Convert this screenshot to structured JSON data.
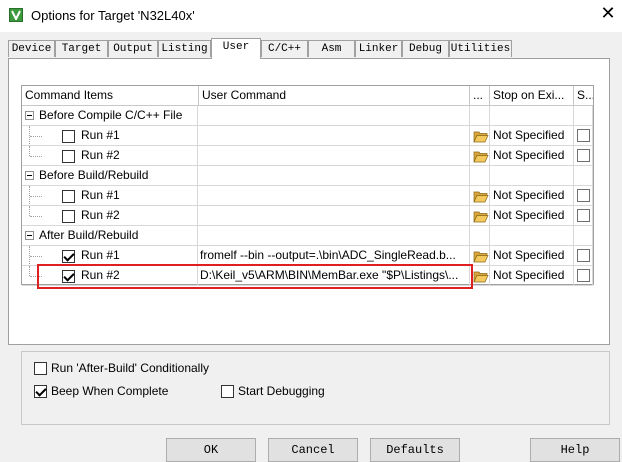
{
  "window": {
    "title": "Options for Target 'N32L40x'",
    "close_glyph": "✕"
  },
  "tabs": [
    {
      "label": "Device"
    },
    {
      "label": "Target"
    },
    {
      "label": "Output"
    },
    {
      "label": "Listing"
    },
    {
      "label": "User"
    },
    {
      "label": "C/C++"
    },
    {
      "label": "Asm"
    },
    {
      "label": "Linker"
    },
    {
      "label": "Debug"
    },
    {
      "label": "Utilities"
    }
  ],
  "active_tab": "User",
  "grid": {
    "headers": {
      "items": "Command Items",
      "command": "User Command",
      "browse": "...",
      "stop": "Stop on Exi...",
      "s": "S..."
    },
    "groups": [
      {
        "label": "Before Compile C/C++ File",
        "runs": [
          {
            "label": "Run #1",
            "checked": false,
            "command": "",
            "stop": "Not Specified"
          },
          {
            "label": "Run #2",
            "checked": false,
            "command": "",
            "stop": "Not Specified"
          }
        ]
      },
      {
        "label": "Before Build/Rebuild",
        "runs": [
          {
            "label": "Run #1",
            "checked": false,
            "command": "",
            "stop": "Not Specified"
          },
          {
            "label": "Run #2",
            "checked": false,
            "command": "",
            "stop": "Not Specified"
          }
        ]
      },
      {
        "label": "After Build/Rebuild",
        "runs": [
          {
            "label": "Run #1",
            "checked": true,
            "command": "fromelf --bin --output=.\\bin\\ADC_SingleRead.b...",
            "stop": "Not Specified"
          },
          {
            "label": "Run #2",
            "checked": true,
            "command": "D:\\Keil_v5\\ARM\\BIN\\MemBar.exe \"$P\\Listings\\...",
            "stop": "Not Specified"
          }
        ]
      }
    ]
  },
  "options": {
    "run_after_build": {
      "label": "Run 'After-Build' Conditionally",
      "checked": false
    },
    "beep": {
      "label": "Beep When Complete",
      "checked": true
    },
    "start_debugging": {
      "label": "Start Debugging",
      "checked": false
    }
  },
  "buttons": {
    "ok": "OK",
    "cancel": "Cancel",
    "defaults": "Defaults",
    "help": "Help"
  },
  "icons": {
    "app": "keil-uvision-icon",
    "folder": "folder-open-icon"
  },
  "colors": {
    "highlight": "#e02020",
    "app_icon": "#3c9a3c",
    "folder": "#e8b84a"
  }
}
